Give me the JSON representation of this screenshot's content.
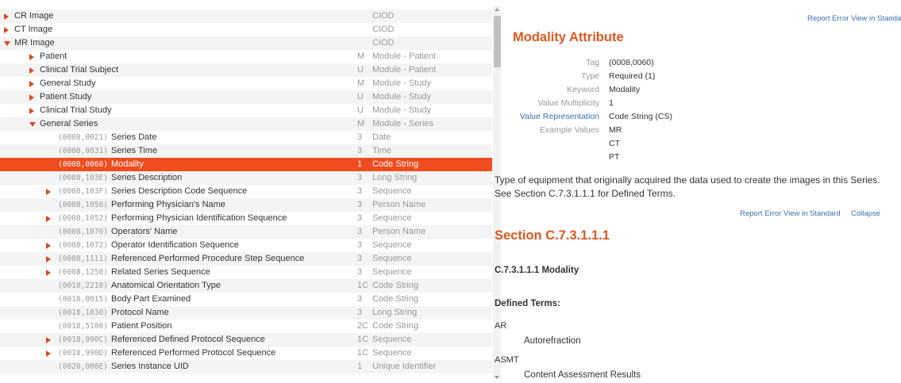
{
  "tree": {
    "rows": [
      {
        "level": 0,
        "arrow": "right",
        "name": "CR Image",
        "tag": "",
        "req": "",
        "type": "CIOD"
      },
      {
        "level": 0,
        "arrow": "right",
        "name": "CT Image",
        "tag": "",
        "req": "",
        "type": "CIOD"
      },
      {
        "level": 0,
        "arrow": "down",
        "name": "MR Image",
        "tag": "",
        "req": "",
        "type": "CIOD"
      },
      {
        "level": 1,
        "arrow": "right",
        "name": "Patient",
        "tag": "",
        "req": "M",
        "type": "Module - Patient"
      },
      {
        "level": 1,
        "arrow": "right",
        "name": "Clinical Trial Subject",
        "tag": "",
        "req": "U",
        "type": "Module - Patient"
      },
      {
        "level": 1,
        "arrow": "right",
        "name": "General Study",
        "tag": "",
        "req": "M",
        "type": "Module - Study"
      },
      {
        "level": 1,
        "arrow": "right",
        "name": "Patient Study",
        "tag": "",
        "req": "U",
        "type": "Module - Study"
      },
      {
        "level": 1,
        "arrow": "right",
        "name": "Clinical Trial Study",
        "tag": "",
        "req": "U",
        "type": "Module - Study"
      },
      {
        "level": 1,
        "arrow": "down",
        "name": "General Series",
        "tag": "",
        "req": "M",
        "type": "Module - Series"
      },
      {
        "level": 2,
        "arrow": "",
        "name": "Series Date",
        "tag": "(0008,0021)",
        "req": "3",
        "type": "Date"
      },
      {
        "level": 2,
        "arrow": "",
        "name": "Series Time",
        "tag": "(0008,0031)",
        "req": "3",
        "type": "Time"
      },
      {
        "level": 2,
        "arrow": "",
        "name": "Modality",
        "tag": "(0008,0060)",
        "req": "1",
        "type": "Code String",
        "selected": true
      },
      {
        "level": 2,
        "arrow": "",
        "name": "Series Description",
        "tag": "(0008,103E)",
        "req": "3",
        "type": "Long String"
      },
      {
        "level": 2,
        "arrow": "right",
        "name": "Series Description Code Sequence",
        "tag": "(0008,103F)",
        "req": "3",
        "type": "Sequence"
      },
      {
        "level": 2,
        "arrow": "",
        "name": "Performing Physician's Name",
        "tag": "(0008,1050)",
        "req": "3",
        "type": "Person Name"
      },
      {
        "level": 2,
        "arrow": "right",
        "name": "Performing Physician Identification Sequence",
        "tag": "(0008,1052)",
        "req": "3",
        "type": "Sequence"
      },
      {
        "level": 2,
        "arrow": "",
        "name": "Operators' Name",
        "tag": "(0008,1070)",
        "req": "3",
        "type": "Person Name"
      },
      {
        "level": 2,
        "arrow": "right",
        "name": "Operator Identification Sequence",
        "tag": "(0008,1072)",
        "req": "3",
        "type": "Sequence"
      },
      {
        "level": 2,
        "arrow": "right",
        "name": "Referenced Performed Procedure Step Sequence",
        "tag": "(0008,1111)",
        "req": "3",
        "type": "Sequence"
      },
      {
        "level": 2,
        "arrow": "right",
        "name": "Related Series Sequence",
        "tag": "(0008,1250)",
        "req": "3",
        "type": "Sequence"
      },
      {
        "level": 2,
        "arrow": "",
        "name": "Anatomical Orientation Type",
        "tag": "(0010,2210)",
        "req": "1C",
        "type": "Code String"
      },
      {
        "level": 2,
        "arrow": "",
        "name": "Body Part Examined",
        "tag": "(0018,0015)",
        "req": "3",
        "type": "Code String"
      },
      {
        "level": 2,
        "arrow": "",
        "name": "Protocol Name",
        "tag": "(0018,1030)",
        "req": "3",
        "type": "Long String"
      },
      {
        "level": 2,
        "arrow": "",
        "name": "Patient Position",
        "tag": "(0018,5100)",
        "req": "2C",
        "type": "Code String"
      },
      {
        "level": 2,
        "arrow": "right",
        "name": "Referenced Defined Protocol Sequence",
        "tag": "(0018,990C)",
        "req": "1C",
        "type": "Sequence"
      },
      {
        "level": 2,
        "arrow": "right",
        "name": "Referenced Performed Protocol Sequence",
        "tag": "(0018,990D)",
        "req": "1C",
        "type": "Sequence"
      },
      {
        "level": 2,
        "arrow": "",
        "name": "Series Instance UID",
        "tag": "(0020,000E)",
        "req": "1",
        "type": "Unique Identifier"
      }
    ]
  },
  "detail": {
    "top_links": {
      "report_error": "Report Error",
      "view_in_standard": "View in Standard"
    },
    "title": "Modality Attribute",
    "attributes": {
      "tag_label": "Tag",
      "tag_value": "(0008,0060)",
      "type_label": "Type",
      "type_value": "Required (1)",
      "keyword_label": "Keyword",
      "keyword_value": "Modality",
      "vm_label": "Value Multiplicity",
      "vm_value": "1",
      "vr_label": "Value Representation",
      "vr_value": "Code String (CS)",
      "example_label": "Example Values",
      "examples": [
        "MR",
        "CT",
        "PT"
      ]
    },
    "description": "Type of equipment that originally acquired the data used to create the images in this Series. See Section C.7.3.1.1.1 for Defined Terms.",
    "section_links": {
      "report_error": "Report Error",
      "view_in_standard": "View in Standard",
      "collapse": "Collapse"
    },
    "section_title": "Section C.7.3.1.1.1",
    "section_heading": "C.7.3.1.1.1 Modality",
    "defined_terms_heading": "Defined Terms:",
    "terms": [
      {
        "code": "AR",
        "meaning": "Autorefraction"
      },
      {
        "code": "ASMT",
        "meaning": "Content Assessment Results"
      }
    ]
  }
}
